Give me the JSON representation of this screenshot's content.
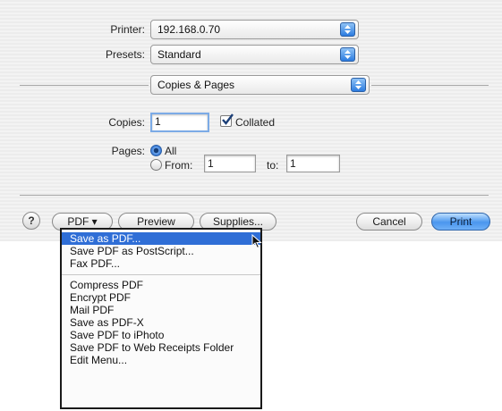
{
  "dialog": {
    "printer_label": "Printer:",
    "printer_value": "192.168.0.70",
    "presets_label": "Presets:",
    "presets_value": "Standard",
    "pane_value": "Copies & Pages",
    "copies_label": "Copies:",
    "copies_value": "1",
    "collated_label": "Collated",
    "collated_checked": true,
    "pages_label": "Pages:",
    "pages_all_label": "All",
    "pages_from_label": "From:",
    "pages_from_value": "1",
    "pages_to_label": "to:",
    "pages_to_value": "1",
    "pages_selected": "All"
  },
  "footer": {
    "help_label": "?",
    "pdf_label": "PDF ▾",
    "preview_label": "Preview",
    "supplies_label": "Supplies...",
    "cancel_label": "Cancel",
    "print_label": "Print"
  },
  "pdf_menu": {
    "group1": [
      "Save as PDF...",
      "Save PDF as PostScript...",
      "Fax PDF..."
    ],
    "group2": [
      "Compress PDF",
      "Encrypt PDF",
      "Mail PDF",
      "Save as PDF-X",
      "Save PDF to iPhoto",
      "Save PDF to Web Receipts Folder",
      "Edit Menu..."
    ],
    "highlighted": "Save as PDF..."
  },
  "colors": {
    "accent": "#2f6ed6",
    "default_button": "#4a96ee",
    "sheet_background": "#ececec"
  },
  "icons": {
    "popup_arrows": "up-down-arrows-icon",
    "checkmark": "checkmark-icon",
    "cursor": "mouse-pointer-icon"
  }
}
